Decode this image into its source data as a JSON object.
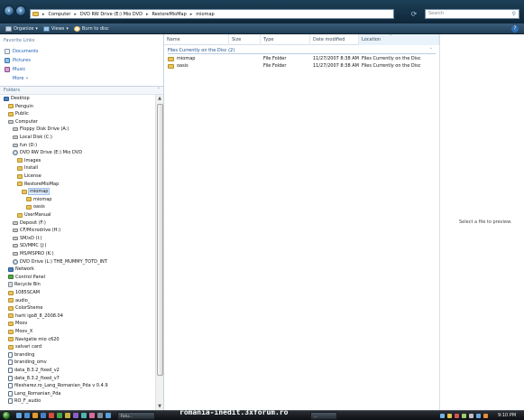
{
  "address_bar": {
    "crumbs": [
      "Computer",
      "DVD RW Drive (E:) Mio DVD",
      "RestoreMioMap",
      "miomap"
    ],
    "search_placeholder": "Search"
  },
  "toolbar": {
    "organize_label": "Organize",
    "views_label": "Views",
    "burn_label": "Burn to disc"
  },
  "favorites": {
    "title": "Favorite Links",
    "items": [
      "Documents",
      "Pictures",
      "Music"
    ],
    "more_label": "More"
  },
  "folders": {
    "title": "Folders",
    "tree": [
      {
        "label": "Desktop",
        "icon": "desktop",
        "level": 0
      },
      {
        "label": "Penguin",
        "icon": "user-folder",
        "level": 1
      },
      {
        "label": "Public",
        "icon": "folder",
        "level": 1
      },
      {
        "label": "Computer",
        "icon": "computer",
        "level": 1
      },
      {
        "label": "Floppy Disk Drive (A:)",
        "icon": "floppy",
        "level": 2
      },
      {
        "label": "Local Disk (C:)",
        "icon": "drive",
        "level": 2
      },
      {
        "label": "fun (D:)",
        "icon": "drive",
        "level": 2
      },
      {
        "label": "DVD RW Drive (E:) Mio DVD",
        "icon": "dvd",
        "level": 2
      },
      {
        "label": "Images",
        "icon": "folder",
        "level": 3
      },
      {
        "label": "Install",
        "icon": "folder",
        "level": 3
      },
      {
        "label": "License",
        "icon": "folder",
        "level": 3
      },
      {
        "label": "RestoreMioMap",
        "icon": "folder",
        "level": 3
      },
      {
        "label": "miomap",
        "icon": "folder",
        "level": 4,
        "selected": true
      },
      {
        "label": "miomap",
        "icon": "folder",
        "level": 5
      },
      {
        "label": "oasis",
        "icon": "folder",
        "level": 5
      },
      {
        "label": "UserManual",
        "icon": "folder",
        "level": 3
      },
      {
        "label": "Deposit (F:)",
        "icon": "drive",
        "level": 2
      },
      {
        "label": "CF/Microdrive (H:)",
        "icon": "drive",
        "level": 2
      },
      {
        "label": "SM/xD (I:)",
        "icon": "drive",
        "level": 2
      },
      {
        "label": "SD/MMC (J:)",
        "icon": "drive",
        "level": 2
      },
      {
        "label": "MS/MSPRO (K:)",
        "icon": "drive",
        "level": 2
      },
      {
        "label": "DVD Drive (L:) THE_MUMMY_TOTD_INT",
        "icon": "dvd",
        "level": 2
      },
      {
        "label": "Network",
        "icon": "network",
        "level": 1
      },
      {
        "label": "Control Panel",
        "icon": "control-panel",
        "level": 1
      },
      {
        "label": "Recycle Bin",
        "icon": "recycle-bin",
        "level": 1
      },
      {
        "label": "1085SCAM",
        "icon": "folder",
        "level": 1
      },
      {
        "label": "audio_",
        "icon": "folder",
        "level": 1
      },
      {
        "label": "ColorSheme",
        "icon": "folder",
        "level": 1
      },
      {
        "label": "harti igo8_8_2008.04",
        "icon": "folder",
        "level": 1
      },
      {
        "label": "Moov",
        "icon": "folder",
        "level": 1
      },
      {
        "label": "Moov_X",
        "icon": "folder",
        "level": 1
      },
      {
        "label": "Navigatie mio c620",
        "icon": "folder",
        "level": 1
      },
      {
        "label": "salvari card",
        "icon": "folder",
        "level": 1
      },
      {
        "label": "branding",
        "icon": "file",
        "level": 1
      },
      {
        "label": "branding_omv",
        "icon": "file",
        "level": 1
      },
      {
        "label": "data_8.3.2_fixed_v2",
        "icon": "file",
        "level": 1
      },
      {
        "label": "data_8.3.2_fixed_v7",
        "icon": "file",
        "level": 1
      },
      {
        "label": "filesharez.ro_Lang_Romanian_Pda v 0.4.9",
        "icon": "file",
        "level": 1
      },
      {
        "label": "Lang_Romanian_Pda",
        "icon": "file",
        "level": 1
      },
      {
        "label": "RO_F_audio",
        "icon": "file",
        "level": 1
      }
    ]
  },
  "file_list": {
    "columns": [
      "Name",
      "Size",
      "Type",
      "Date modified",
      "Location"
    ],
    "group_header": "Files Currently on the Disc (2)",
    "rows": [
      {
        "name": "miomap",
        "size": "",
        "type": "File Folder",
        "date": "11/27/2007 8:38 AM",
        "location": "Files Currently on the Disc"
      },
      {
        "name": "oasis",
        "size": "",
        "type": "File Folder",
        "date": "11/27/2007 8:38 AM",
        "location": "Files Currently on the Disc"
      }
    ]
  },
  "preview": {
    "message": "Select a file to preview."
  },
  "taskbar": {
    "buttons": [
      "Foru...",
      "..."
    ],
    "watermark": "romania-inedit.3xforum.ro",
    "clock": "9:10 PM"
  },
  "colors": {
    "addr_bar": "#1c3f57",
    "toolbar": "#2c4b66",
    "link": "#1a5fb4",
    "group_header": "#1e4f8a"
  }
}
